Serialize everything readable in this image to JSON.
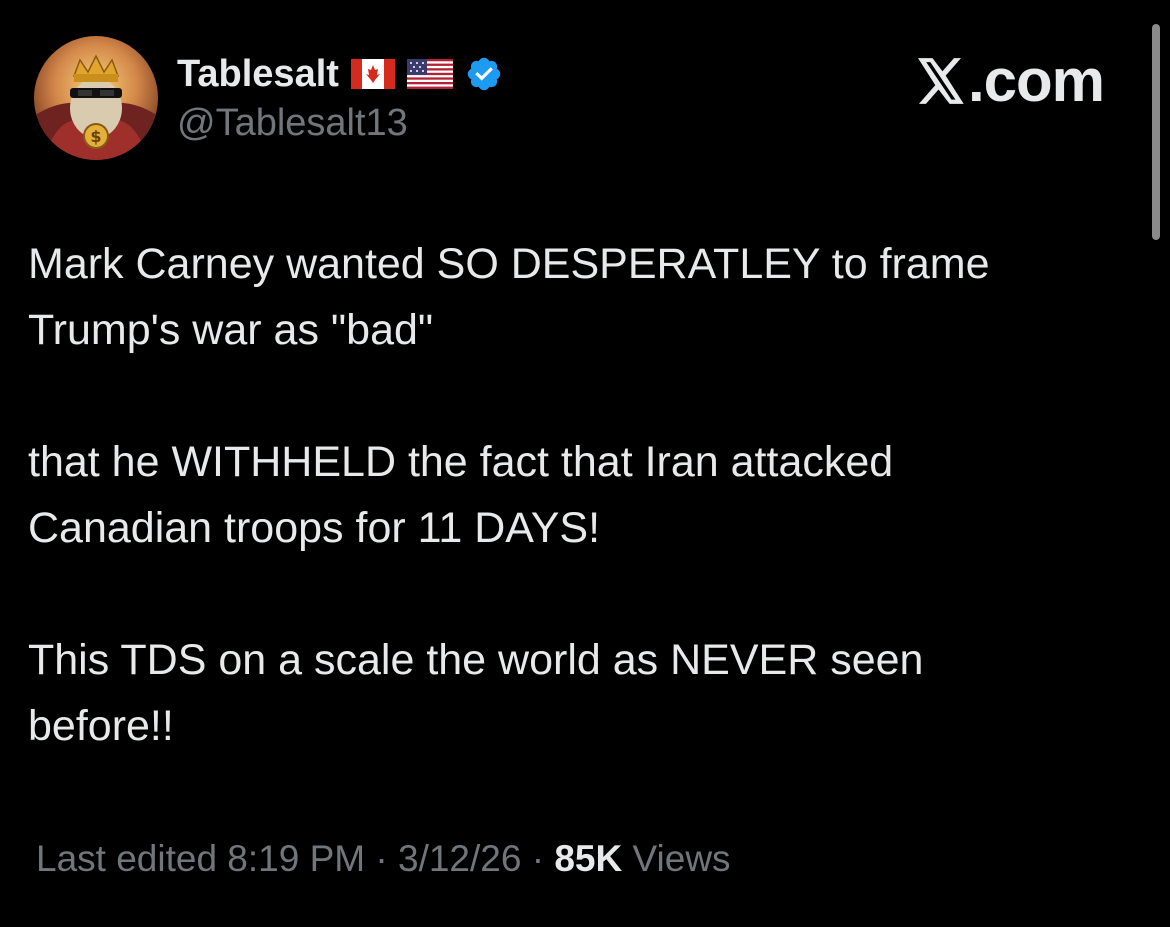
{
  "author": {
    "display_name": "Tablesalt",
    "handle": "@Tablesalt13",
    "flags": [
      "canada-flag",
      "usa-flag"
    ],
    "verified_icon": "verified-badge-icon",
    "avatar_icon": "avatar-image"
  },
  "brand": {
    "label": ".com",
    "icon": "x-logo-icon"
  },
  "post": {
    "paragraphs": [
      [
        "Mark Carney wanted SO DESPERATLEY to frame",
        "Trump's war as \"bad\""
      ],
      [
        "that he WITHHELD the fact that Iran attacked",
        "Canadian troops for 11 DAYS!"
      ],
      [
        "This TDS on a scale the world as NEVER seen",
        "before!!"
      ]
    ]
  },
  "meta": {
    "edited_label": "Last edited 8:19 PM",
    "separator": "·",
    "date": "3/12/26",
    "views_count": "85K",
    "views_label": "Views"
  },
  "colors": {
    "background": "#000000",
    "primary_text": "#e7e9ea",
    "secondary_text": "#71767b",
    "verified_blue": "#1d9bf0"
  }
}
